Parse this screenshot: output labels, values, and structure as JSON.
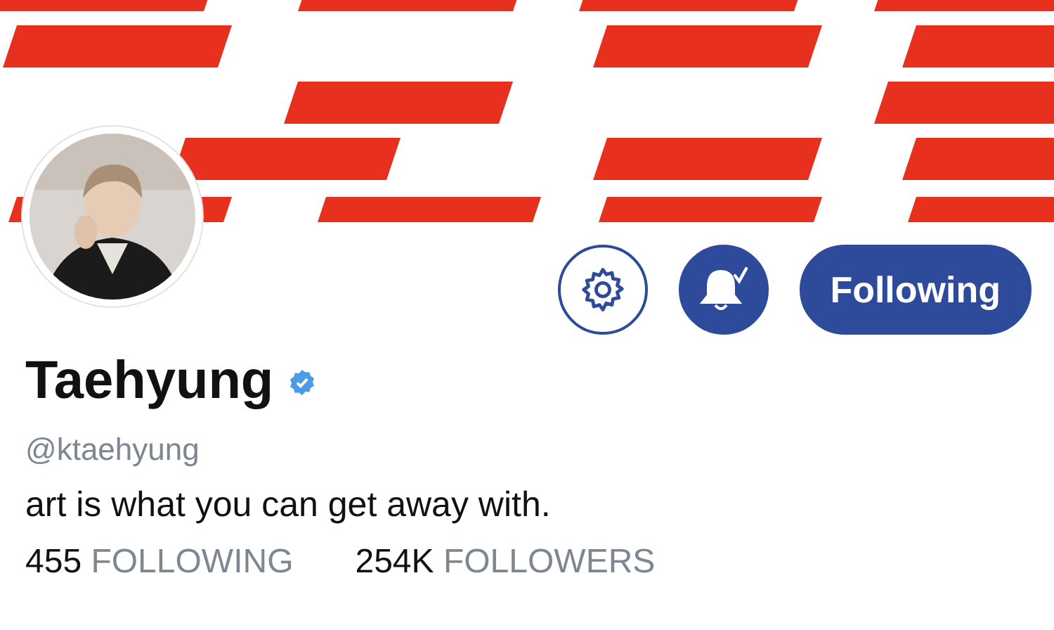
{
  "actions": {
    "notifications_on": true,
    "follow_button": {
      "label": "Following",
      "following": true
    }
  },
  "profile": {
    "name": "Taehyung",
    "verified": true,
    "handle": "@ktaehyung",
    "bio": "art is what you can get away with."
  },
  "stats": [
    {
      "count": "455",
      "label": "FOLLOWING"
    },
    {
      "count": "254K",
      "label": "FOLLOWERS"
    }
  ]
}
